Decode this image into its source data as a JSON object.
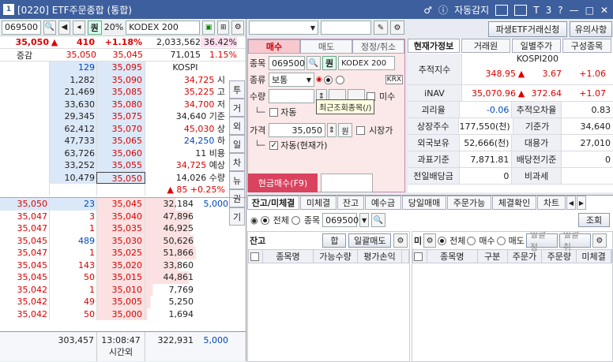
{
  "window": {
    "title": "[0220] ETF주문종합 (통합)",
    "icon_label": "1",
    "help_label": "자동감지",
    "right_icons": [
      "T",
      "3",
      "?"
    ]
  },
  "left": {
    "code": "069500",
    "ratio_badge": "20%",
    "name": "KODEX 200",
    "quote": {
      "price": "35,050",
      "arrow": "▲",
      "change": "410",
      "pct": "+1.18%",
      "volume": "2,033,562",
      "vol_pct": "36.42%"
    },
    "subquote": {
      "label": "증감",
      "price1": "35,050",
      "price2": "35,045",
      "val": "71,015",
      "pct": "1.15%"
    },
    "asks": [
      {
        "qty": "129",
        "price": "35,095"
      },
      {
        "qty": "1,282",
        "price": "35,090"
      },
      {
        "qty": "21,469",
        "price": "35,085"
      },
      {
        "qty": "33,630",
        "price": "35,080"
      },
      {
        "qty": "29,345",
        "price": "35,075"
      },
      {
        "qty": "62,412",
        "price": "35,070"
      },
      {
        "qty": "47,733",
        "price": "35,065"
      },
      {
        "qty": "63,726",
        "price": "35,060"
      },
      {
        "qty": "33,252",
        "price": "35,055"
      },
      {
        "qty": "10,479",
        "price": "35,050"
      }
    ],
    "index_info": [
      {
        "value": "KOSPI",
        "label": ""
      },
      {
        "value": "34,725",
        "label": "시"
      },
      {
        "value": "35,225",
        "label": "고"
      },
      {
        "value": "34,700",
        "label": "저"
      },
      {
        "value": "34,640",
        "label": "기준"
      },
      {
        "value": "45,030",
        "label": "상"
      },
      {
        "value": "24,250",
        "label": "하"
      },
      {
        "value": "11",
        "label": "비용"
      },
      {
        "value": "",
        "label": ""
      },
      {
        "value": "34,725",
        "label": "예상"
      },
      {
        "value": "14,026",
        "label": "수량"
      },
      {
        "value": "▲ 85",
        "label": "+0.25%"
      }
    ],
    "side_buttons": [
      "투",
      "거",
      "외",
      "일",
      "차",
      "뉴",
      "권",
      "기"
    ],
    "bids": [
      {
        "price": "35,050",
        "qty": "23",
        "bid": "35,045",
        "bqty": "32,184"
      },
      {
        "price": "35,047",
        "qty": "3",
        "bid": "35,040",
        "bqty": "47,896"
      },
      {
        "price": "35,047",
        "qty": "1",
        "bid": "35,035",
        "bqty": "46,925"
      },
      {
        "price": "35,045",
        "qty": "489",
        "bid": "35,030",
        "bqty": "50,626"
      },
      {
        "price": "35,047",
        "qty": "1",
        "bid": "35,025",
        "bqty": "51,866"
      },
      {
        "price": "35,045",
        "qty": "143",
        "bid": "35,020",
        "bqty": "33,860"
      },
      {
        "price": "35,045",
        "qty": "50",
        "bid": "35,015",
        "bqty": "44,861"
      },
      {
        "price": "35,042",
        "qty": "1",
        "bid": "35,010",
        "bqty": "7,769"
      },
      {
        "price": "35,042",
        "qty": "49",
        "bid": "35,005",
        "bqty": "5,250"
      },
      {
        "price": "35,042",
        "qty": "50",
        "bid": "35,000",
        "bqty": "1,694"
      }
    ],
    "bid_extra": "5,000",
    "footer": {
      "total_ask": "303,457",
      "time": "13:08:47",
      "time_label": "시간외",
      "total_bid": "322,931",
      "extra": "5,000"
    }
  },
  "top_buttons": {
    "derivatives": "파생ETF거래신청",
    "notice": "유의사항"
  },
  "order": {
    "tabs": [
      "매수",
      "매도",
      "정정/취소"
    ],
    "code_label": "종목",
    "code": "069500",
    "name": "KODEX 200",
    "type_label": "종류",
    "type_value": "보통",
    "krx": "KRX",
    "tooltip": "최근조회종목(/)",
    "qty_label": "수량",
    "buy_all": "미수",
    "auto_label": "자동",
    "price_label": "가격",
    "price": "35,050",
    "won": "원",
    "market_label": "시장가",
    "auto_current": "자동(현재가)",
    "submit": "현금매수(F9)"
  },
  "info": {
    "tabs": [
      "현재가정보",
      "거래원",
      "일별주가",
      "구성종목"
    ],
    "index_label": "추적지수",
    "index_name": "KOSPI200",
    "index_val": "348.95",
    "index_chg": "3.67",
    "index_pct": "+1.06",
    "inav_label": "iNAV",
    "inav_val": "35,070.96",
    "inav_chg": "372.64",
    "inav_pct": "+1.07",
    "rows": [
      {
        "l1": "괴리율",
        "v1": "-0.06",
        "l2": "추적오차율",
        "v2": "0.83"
      },
      {
        "l1": "상장주수",
        "v1": "177,550(천)",
        "l2": "기준가",
        "v2": "34,640"
      },
      {
        "l1": "외국보유",
        "v1": "52,666(천)",
        "l2": "대용가",
        "v2": "27,010"
      },
      {
        "l1": "과표기준",
        "v1": "7,871.81",
        "l2": "배당전기준",
        "v2": "0"
      },
      {
        "l1": "전일배당금",
        "v1": "0",
        "l2": "비과세",
        "v2": ""
      }
    ]
  },
  "bottom": {
    "tabs": [
      "잔고/미체결",
      "미체결",
      "잔고",
      "예수금",
      "당일매매",
      "주문가능",
      "체결확인",
      "차트"
    ],
    "filter_all": "전체",
    "filter_item": "종목",
    "code": "069500",
    "search": "조회",
    "left_title": "잔고",
    "left_btn1": "합",
    "left_btn2": "일괄매도",
    "left_cols": [
      "종목명",
      "가능수량",
      "평가손익"
    ],
    "right_title": "미",
    "right_filters": [
      "전체",
      "매수",
      "매도"
    ],
    "right_btn1": "일괄정",
    "right_btn2": "일괄취",
    "right_cols": [
      "종목명",
      "구분",
      "주문가",
      "주문량",
      "미체결"
    ]
  },
  "colors": {
    "ask_bg": "#dbe8f8",
    "bid_bg": "#fbe1e1",
    "up": "#d00",
    "down": "#0046be",
    "title": "#3d5f9d",
    "submit": "#d9435e"
  }
}
